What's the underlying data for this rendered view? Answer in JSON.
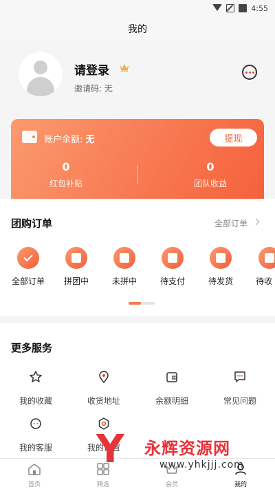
{
  "status_bar": {
    "time": "4:55"
  },
  "header": {
    "title": "我的"
  },
  "profile": {
    "login_label": "请登录",
    "invite_code_label": "邀请码: 无"
  },
  "balance": {
    "label": "账户余额:",
    "value": "无",
    "withdraw_label": "提现",
    "stats": [
      {
        "value": "0",
        "label": "红包补贴"
      },
      {
        "value": "0",
        "label": "团队收益"
      }
    ]
  },
  "orders": {
    "title": "团购订单",
    "all_label": "全部订单",
    "items": [
      {
        "label": "全部订单",
        "icon": "check-icon"
      },
      {
        "label": "拼团中",
        "icon": "group-bag-icon"
      },
      {
        "label": "未拼中",
        "icon": "failed-bag-icon"
      },
      {
        "label": "待支付",
        "icon": "yen-icon"
      },
      {
        "label": "待发货",
        "icon": "truck-icon"
      },
      {
        "label": "待收",
        "icon": "receive-icon"
      }
    ]
  },
  "services": {
    "title": "更多服务",
    "items": [
      {
        "label": "我的收藏",
        "icon": "star-icon"
      },
      {
        "label": "收货地址",
        "icon": "location-icon"
      },
      {
        "label": "余额明细",
        "icon": "wallet-icon"
      },
      {
        "label": "常见问题",
        "icon": "question-chat-icon"
      },
      {
        "label": "我的客服",
        "icon": "headset-icon"
      },
      {
        "label": "我的设置",
        "icon": "settings-icon"
      }
    ]
  },
  "tabs": [
    {
      "label": "首页",
      "icon": "home-icon"
    },
    {
      "label": "精选",
      "icon": "grid-icon"
    },
    {
      "label": "会员",
      "icon": "member-icon"
    },
    {
      "label": "我的",
      "icon": "profile-icon"
    }
  ],
  "watermark": {
    "title": "永辉资源网",
    "url": "www.yhkjjj.com"
  },
  "colors": {
    "accent": "#f5613b",
    "accent_light": "#fb9a6e"
  }
}
